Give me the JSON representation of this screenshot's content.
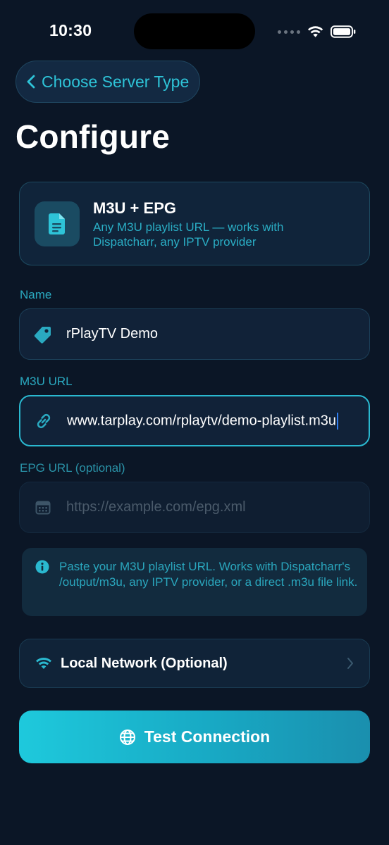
{
  "status_bar": {
    "time": "10:30"
  },
  "nav": {
    "back_label": "Choose Server Type"
  },
  "page": {
    "title": "Configure"
  },
  "server_type": {
    "title": "M3U + EPG",
    "description": "Any M3U playlist URL — works with Dispatcharr, any IPTV provider",
    "icon": "document-icon"
  },
  "fields": {
    "name": {
      "label": "Name",
      "value": "rPlayTV Demo",
      "icon": "tag-icon"
    },
    "m3u_url": {
      "label": "M3U URL",
      "value": "www.tarplay.com/rplaytv/demo-playlist.m3u",
      "icon": "link-icon"
    },
    "epg_url": {
      "label": "EPG URL (optional)",
      "placeholder": "https://example.com/epg.xml",
      "icon": "calendar-icon"
    }
  },
  "info": {
    "text": "Paste your M3U playlist URL. Works with Dispatcharr's /output/m3u, any IPTV provider, or a direct .m3u file link.",
    "icon": "info-icon"
  },
  "local_network": {
    "label": "Local Network (Optional)",
    "icon": "wifi-icon"
  },
  "actions": {
    "test_label": "Test Connection",
    "test_icon": "globe-icon"
  },
  "colors": {
    "accent": "#2ec4d8",
    "background": "#0b1626",
    "card": "#112238"
  }
}
